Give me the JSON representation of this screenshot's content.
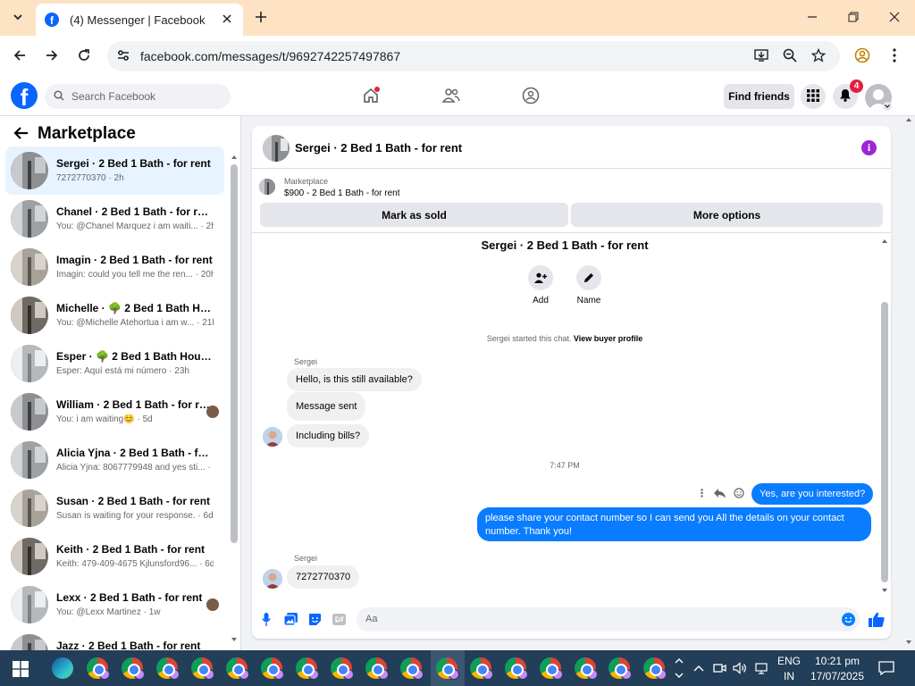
{
  "browser": {
    "tab_title": "(4) Messenger | Facebook",
    "url": "facebook.com/messages/t/9692742257497867"
  },
  "fb": {
    "search_placeholder": "Search Facebook",
    "find_friends": "Find friends",
    "notifications_count": "4"
  },
  "sidebar": {
    "title": "Marketplace",
    "conversations": [
      {
        "name": "Sergei · 2 Bed 1 Bath - for rent",
        "snippet": "7272770370 · 2h",
        "active": true
      },
      {
        "name": "Chanel · 2 Bed 1 Bath - for rent",
        "snippet": "You: @Chanel Marquez i am waiti... · 2h"
      },
      {
        "name": "Imagin · 2 Bed 1 Bath - for rent",
        "snippet": "Imagin: could you tell me the ren... · 20h"
      },
      {
        "name": "Michelle · 🌳 2 Bed 1 Bath Hous...",
        "snippet": "You: @Michelle Atehortua i am w... · 21h"
      },
      {
        "name": "Esper · 🌳 2 Bed 1 Bath House f...",
        "snippet": "Esper: Aquí está mi número · 23h"
      },
      {
        "name": "William · 2 Bed 1 Bath - for re...",
        "snippet": "You: i am waiting😊 · 5d"
      },
      {
        "name": "Alicia Yjna · 2 Bed 1 Bath - for r...",
        "snippet": "Alicia Yjna: 8067779948 and yes sti... · 6d"
      },
      {
        "name": "Susan · 2 Bed 1 Bath - for rent",
        "snippet": "Susan is waiting for your response. · 6d"
      },
      {
        "name": "Keith · 2 Bed 1 Bath - for rent",
        "snippet": "Keith: 479-409-4675 Kjlunsford96... · 6d"
      },
      {
        "name": "Lexx · 2 Bed 1 Bath - for rent",
        "snippet": "You: @Lexx Martinez · 1w"
      },
      {
        "name": "Jazz · 2 Bed 1 Bath - for rent",
        "snippet": ""
      }
    ]
  },
  "chat": {
    "header_title": "Sergei · 2 Bed 1 Bath - for rent",
    "listing_category": "Marketplace",
    "listing_price": "$900 - 2 Bed 1 Bath - for rent",
    "mark_sold": "Mark as sold",
    "more_options": "More options",
    "conv_title": "Sergei · 2 Bed 1 Bath - for rent",
    "add_label": "Add",
    "name_label": "Name",
    "system_text": "Sergei started this chat.",
    "view_profile": "View buyer profile",
    "sender1": "Sergei",
    "msg1": "Hello, is this still available?",
    "msg2": "Message sent",
    "msg3": "Including bills?",
    "time": "7:47 PM",
    "out1": "Yes, are you interested?",
    "out2": "please share your contact number so I can send you All the details on your contact number. Thank you!",
    "sender2": "Sergei",
    "msg4": "7272770370",
    "input_placeholder": "Aa"
  },
  "taskbar": {
    "lang1": "ENG",
    "lang2": "IN",
    "time": "10:21 pm",
    "date": "17/07/2025"
  },
  "colors": {
    "facebook_blue": "#0866ff",
    "messenger_blue": "#0a7cff",
    "tab_strip": "#fde3c4",
    "active_row": "#e7f3ff",
    "notification_red": "#e41e3f"
  }
}
